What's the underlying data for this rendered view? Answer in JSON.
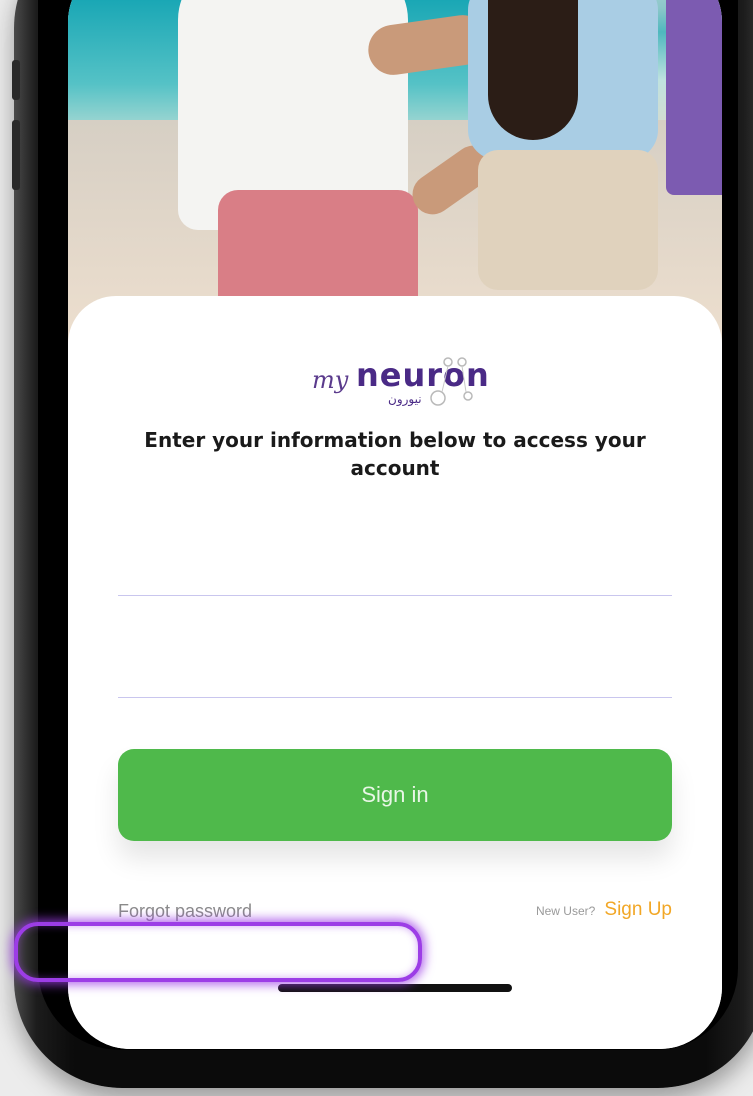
{
  "brand": {
    "logo_my": "my",
    "logo_neuron": "neuron",
    "logo_arabic": "نيورون"
  },
  "login": {
    "title": "Enter your information below to access your account",
    "username_value": "",
    "password_value": "",
    "signin_label": "Sign in",
    "forgot_label": "Forgot password",
    "new_user_label": "New User?",
    "signup_label": "Sign Up"
  },
  "colors": {
    "accent_purple": "#4a2a86",
    "signin_green": "#4fb94b",
    "signup_orange": "#f2a726",
    "highlight_purple": "#9c3de6"
  }
}
